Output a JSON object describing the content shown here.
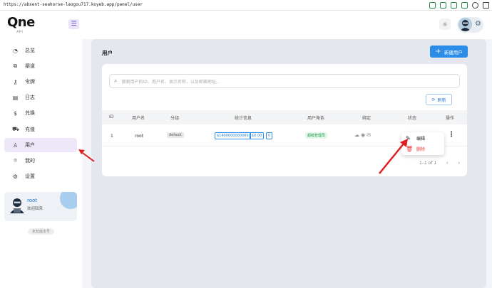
{
  "browser": {
    "url": "https://absent-seahorse-laogou717.koyeb.app/panel/user"
  },
  "logo": {
    "text": "Qne",
    "sub": "API"
  },
  "sidebar": {
    "items": [
      {
        "label": "总览",
        "icon": "gauge-icon",
        "glyph": "◔"
      },
      {
        "label": "渠道",
        "icon": "channel-icon",
        "glyph": "⧉"
      },
      {
        "label": "令牌",
        "icon": "key-icon",
        "glyph": "⚷"
      },
      {
        "label": "日志",
        "icon": "log-icon",
        "glyph": "▤"
      },
      {
        "label": "兑换",
        "icon": "dollar-icon",
        "glyph": "$"
      },
      {
        "label": "充值",
        "icon": "cart-icon",
        "glyph": "⛟"
      },
      {
        "label": "用户",
        "icon": "user-icon",
        "glyph": "♙"
      },
      {
        "label": "我的",
        "icon": "profile-icon",
        "glyph": "⌾"
      },
      {
        "label": "设置",
        "icon": "settings-icon",
        "glyph": "⚙"
      }
    ],
    "active_index": 6,
    "profile": {
      "name": "root",
      "subtitle": "欢迎回来"
    },
    "version": "未知版本号"
  },
  "main": {
    "title": "用户",
    "create_button": "新建用户",
    "search_placeholder": "搜索用户的ID、用户名、显示名称，以及邮箱地址...",
    "refresh_button": "刷新",
    "columns": [
      "ID",
      "用户名",
      "分组",
      "统计信息",
      "用户角色",
      "绑定",
      "状态",
      "操作"
    ],
    "row": {
      "id": "1",
      "username": "root",
      "group": "default",
      "quota": "$1400000000000",
      "quota_2": "$0.00",
      "quota_3": "0",
      "role": "超级管理员"
    },
    "pagination": {
      "text": "1–1 of 1",
      "prev": "‹",
      "next": "›"
    },
    "dropdown": {
      "edit": "编辑",
      "delete": "删除"
    }
  },
  "colors": {
    "accent": "#2b8de8",
    "active_nav": "#ece6f7",
    "arrow": "#e02020",
    "delete": "#e53935"
  }
}
